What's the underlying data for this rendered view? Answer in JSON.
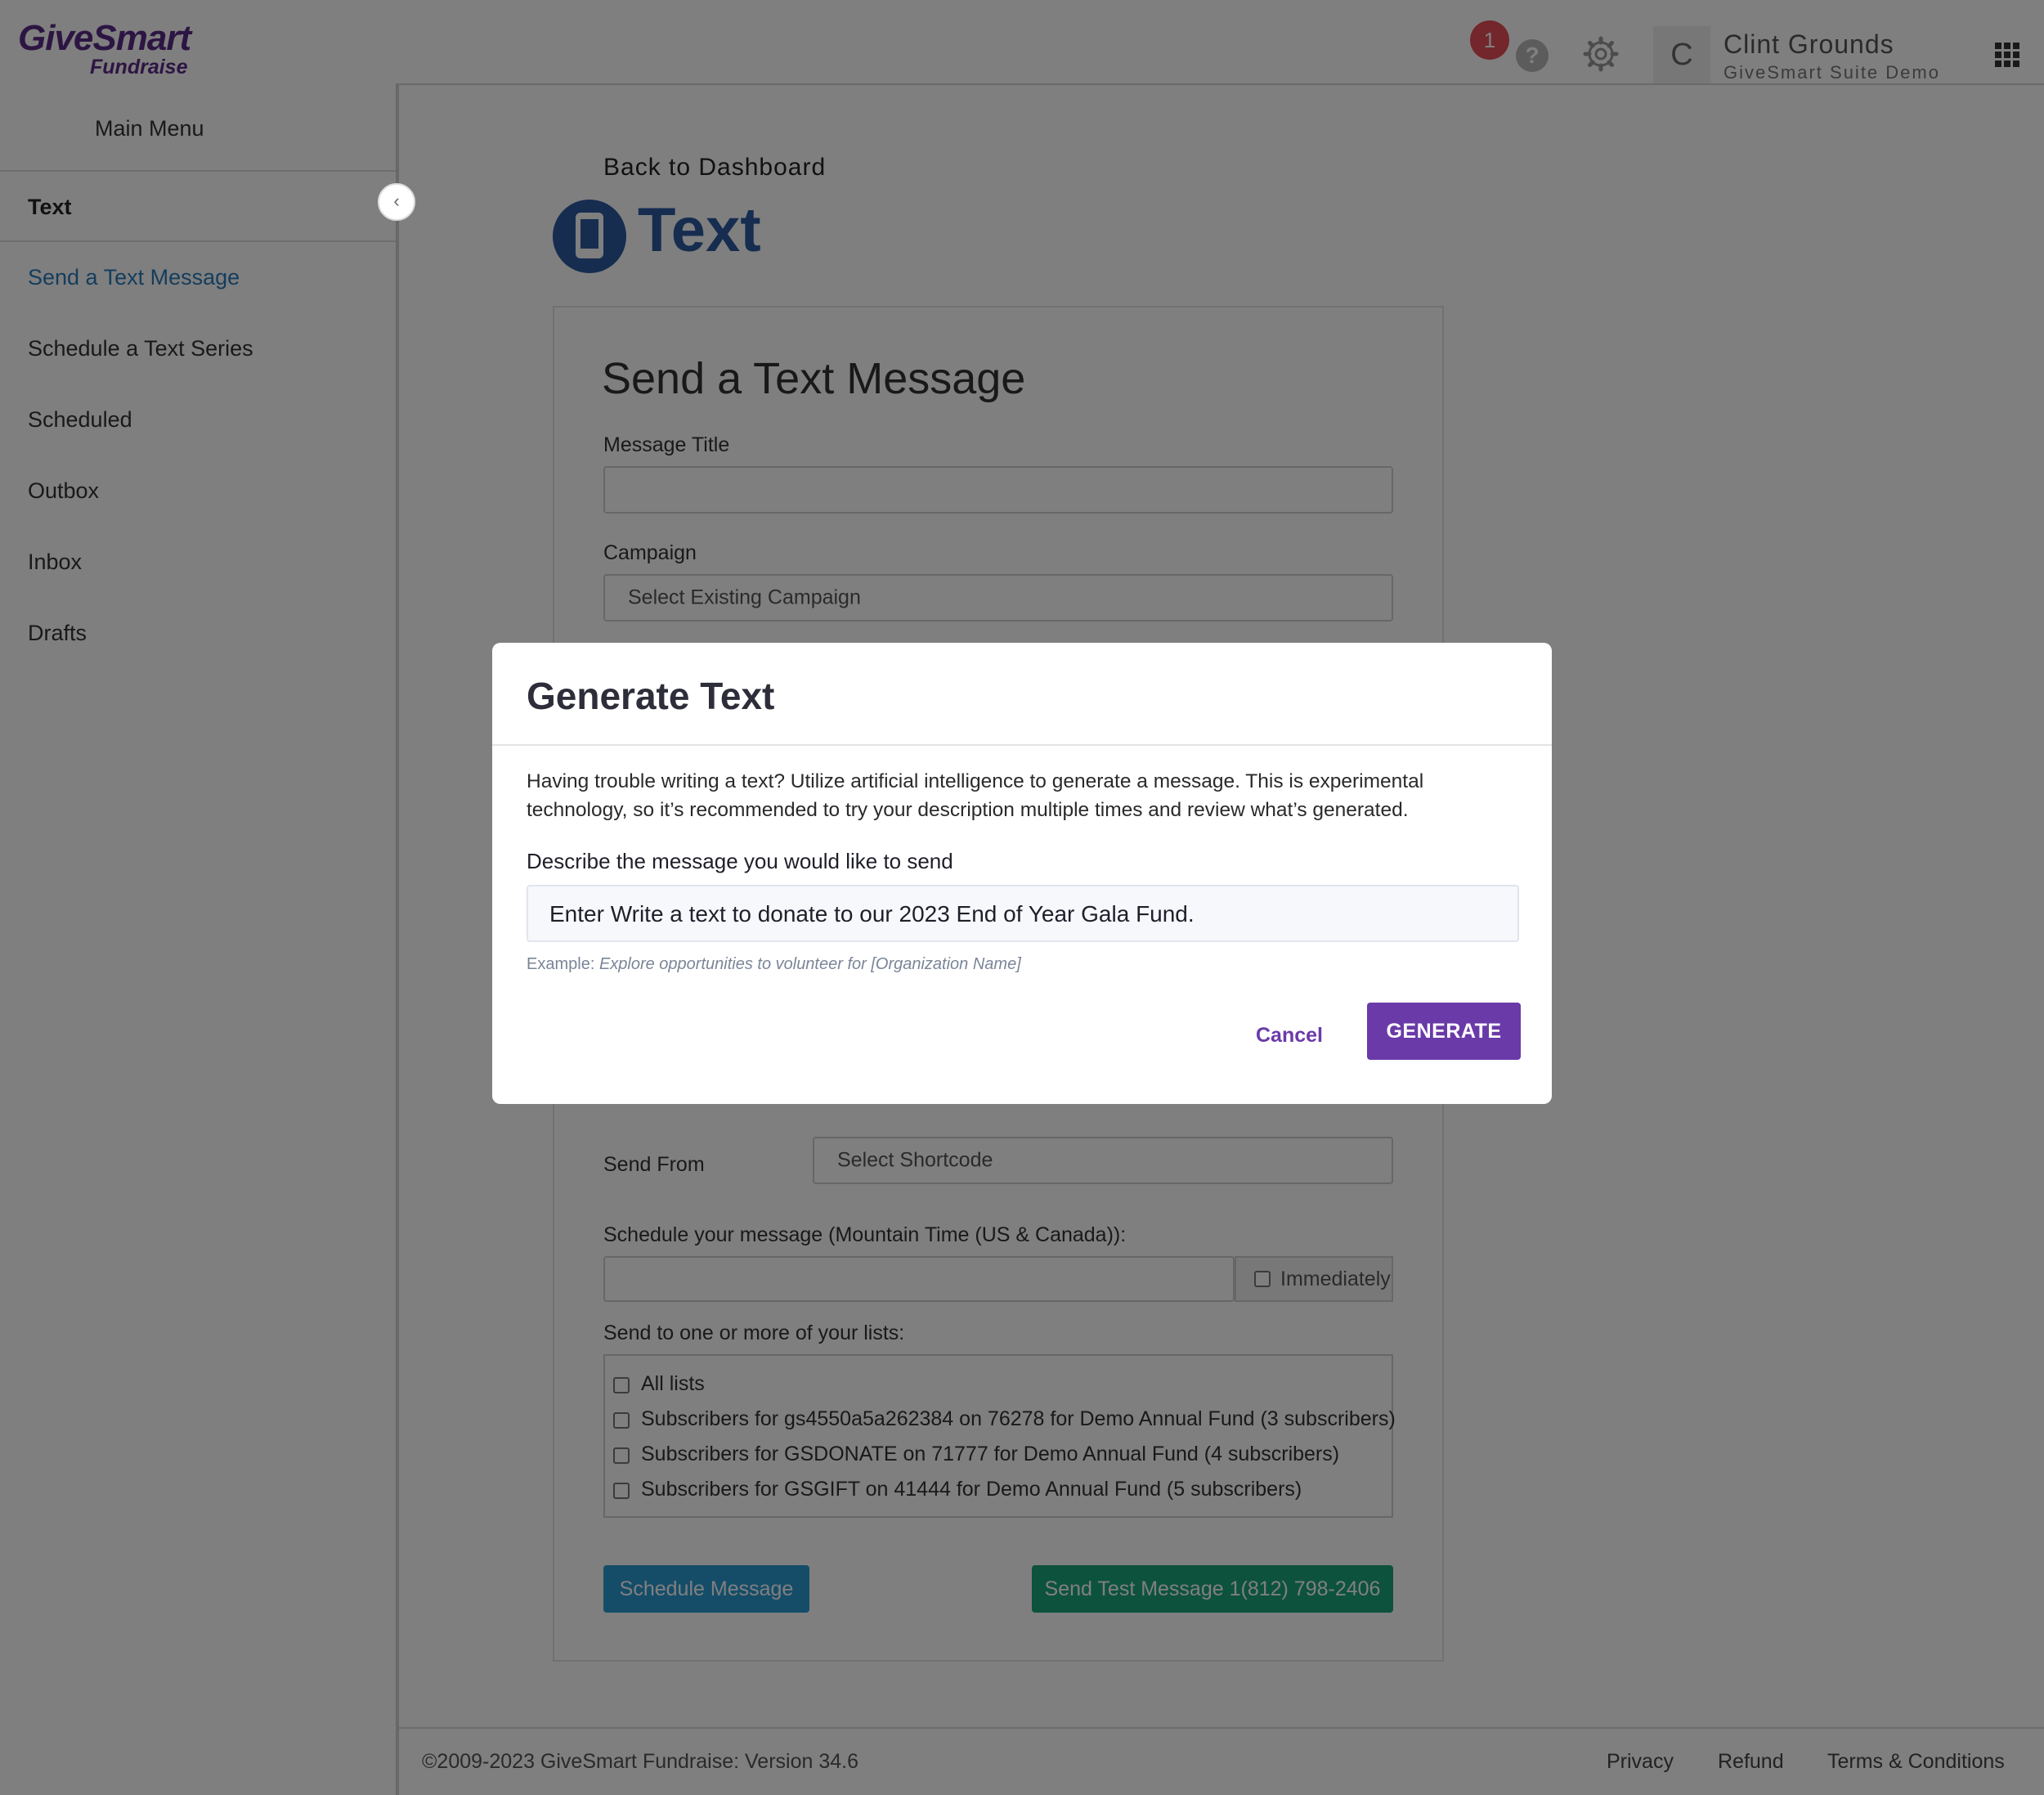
{
  "header": {
    "logo_line1": "GiveSmart",
    "logo_line2": "Fundraise",
    "notification_count": "1",
    "help_glyph": "?",
    "user_initial": "C",
    "user_name": "Clint Grounds",
    "user_org": "GiveSmart Suite Demo",
    "icons": [
      "help-icon",
      "gear-icon",
      "app-grid-icon"
    ]
  },
  "sidebar": {
    "main_menu": "Main Menu",
    "collapse_glyph": "‹",
    "section": "Text",
    "items": [
      {
        "label": "Send a Text Message",
        "active": true
      },
      {
        "label": "Schedule a Text Series"
      },
      {
        "label": "Scheduled"
      },
      {
        "label": "Outbox"
      },
      {
        "label": "Inbox"
      },
      {
        "label": "Drafts"
      }
    ]
  },
  "page": {
    "back_link": "Back to Dashboard",
    "title": "Text",
    "accent_color": "#2c5aa0"
  },
  "form": {
    "title": "Send a Text Message",
    "message_title_label": "Message Title",
    "message_title_value": "",
    "campaign_label": "Campaign",
    "campaign_value": "Select Existing Campaign",
    "send_from_label": "Send From",
    "send_from_value": "Select Shortcode",
    "schedule_label": "Schedule your message (Mountain Time (US & Canada)):",
    "schedule_value": "",
    "immediately_label": "Immediately",
    "lists_label": "Send to one or more of your lists:",
    "lists": [
      "All lists",
      "Subscribers for gs4550a5a262384 on 76278 for Demo Annual Fund (3 subscribers)",
      "Subscribers for GSDONATE on 71777 for Demo Annual Fund (4 subscribers)",
      "Subscribers for GSGIFT on 41444 for Demo Annual Fund (5 subscribers)"
    ],
    "schedule_button": "Schedule Message",
    "test_button": "Send Test Message 1(812) 798-2406"
  },
  "footer": {
    "copyright": "©2009-2023 GiveSmart Fundraise: Version 34.6",
    "privacy": "Privacy",
    "refund": "Refund",
    "terms": "Terms & Conditions"
  },
  "modal": {
    "title": "Generate Text",
    "description": "Having trouble writing a text? Utilize artificial intelligence to generate a message. This is experimental technology, so it’s recommended to try your description multiple times and review what’s generated.",
    "input_label": "Describe the message you would like to send",
    "input_value": "Enter Write a text to donate to our 2023 End of Year Gala Fund.",
    "example_prefix": "Example: ",
    "example_text": "Explore opportunities to volunteer for [Organization Name]",
    "cancel": "Cancel",
    "generate": "GENERATE",
    "brand_color": "#6a3aa8"
  }
}
